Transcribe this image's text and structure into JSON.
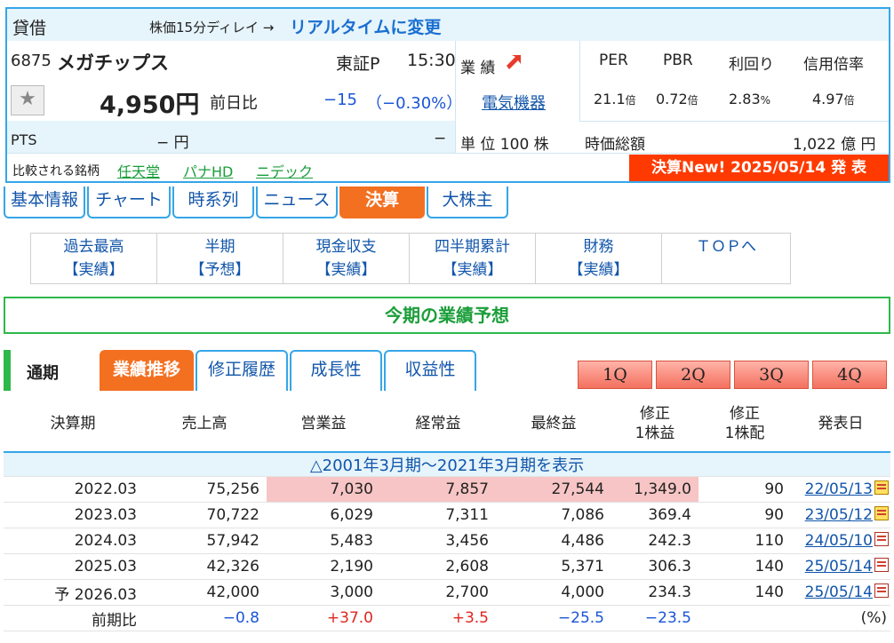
{
  "header": {
    "label_lend": "貸借",
    "delay_note": "株価15分ディレイ →",
    "realtime_link": "リアルタイムに変更",
    "code": "6875",
    "name": "メガチップス",
    "market": "東証P",
    "time": "15:30",
    "price": "4,950円",
    "prev_label": "前日比",
    "change": "−15",
    "change_pct": "（−0.30%）",
    "pts_label": "PTS",
    "pts_value": "− 円",
    "pts_change": "−",
    "perf_label": "業 績",
    "sector": "電気機器",
    "unit": "単 位 100 株",
    "per_label": "PER",
    "per": "21.1",
    "pbr_label": "PBR",
    "pbr": "0.72",
    "yield_label": "利回り",
    "yield": "2.83",
    "margin_label": "信用倍率",
    "margin": "4.97",
    "times_unit": "倍",
    "pct_unit": "%",
    "mcap_label": "時価総額",
    "mcap": "1,022 億 円",
    "compare_label": "比較される銘柄",
    "compare": [
      "任天堂",
      "パナHD",
      "ニデック"
    ],
    "kessan_new": "決算New!  2025/05/14  発 表"
  },
  "tabs": [
    "基本情報",
    "チャート",
    "時系列",
    "ニュース",
    "決算",
    "大株主"
  ],
  "subnav": [
    {
      "l1": "過去最高",
      "l2": "【実績】"
    },
    {
      "l1": "半期",
      "l2": "【予想】"
    },
    {
      "l1": "現金収支",
      "l2": "【実績】"
    },
    {
      "l1": "四半期累計",
      "l2": "【実績】"
    },
    {
      "l1": "財務",
      "l2": "【実績】"
    },
    {
      "l1": "ＴＯＰへ",
      "l2": ""
    }
  ],
  "banner": "今期の業績予想",
  "period_label": "通期",
  "panel_tabs": [
    "業績推移",
    "修正履歴",
    "成長性",
    "収益性"
  ],
  "quarters": [
    "1Q",
    "2Q",
    "3Q",
    "4Q"
  ],
  "table": {
    "headers": [
      "決算期",
      "売上高",
      "営業益",
      "経常益",
      "最終益",
      "修正\n1株益",
      "修正\n1株配",
      "発表日"
    ],
    "show_more": "△2001年3月期〜2021年3月期を表示",
    "rows": [
      {
        "period": "2022.03",
        "sales": "75,256",
        "op": "7,030",
        "ord": "7,857",
        "net": "27,544",
        "eps": "1,349.0",
        "div": "90",
        "date": "22/05/13"
      },
      {
        "period": "2023.03",
        "sales": "70,722",
        "op": "6,029",
        "ord": "7,311",
        "net": "7,086",
        "eps": "369.4",
        "div": "90",
        "date": "23/05/12"
      },
      {
        "period": "2024.03",
        "sales": "57,942",
        "op": "5,483",
        "ord": "3,456",
        "net": "4,486",
        "eps": "242.3",
        "div": "110",
        "date": "24/05/10"
      },
      {
        "period": "2025.03",
        "sales": "42,326",
        "op": "2,190",
        "ord": "2,608",
        "net": "5,371",
        "eps": "306.3",
        "div": "140",
        "date": "25/05/14"
      },
      {
        "period": "予 2026.03",
        "sales": "42,000",
        "op": "3,000",
        "ord": "2,700",
        "net": "4,000",
        "eps": "234.3",
        "div": "140",
        "date": "25/05/14"
      }
    ],
    "yoy": {
      "label": "前期比",
      "sales": "−0.8",
      "op": "+37.0",
      "ord": "+3.5",
      "net": "−25.5",
      "eps": "−23.5",
      "unit": "(%)"
    }
  }
}
